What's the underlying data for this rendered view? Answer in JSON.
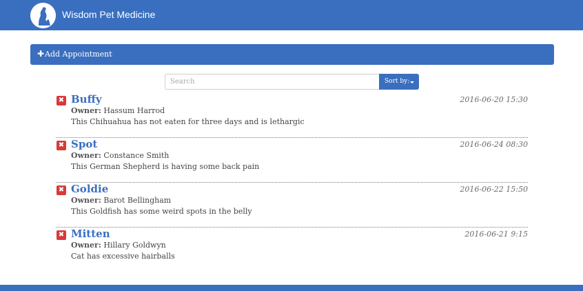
{
  "app": {
    "brand": "Wisdom Pet Medicine"
  },
  "add_appointment": {
    "label": "Add Appointment",
    "icon": "plus-icon"
  },
  "search": {
    "placeholder": "Search",
    "value": ""
  },
  "sort": {
    "label": "Sort by:"
  },
  "appointments": [
    {
      "pet": "Buffy",
      "owner_label": "Owner:",
      "owner": "Hassum Harrod",
      "notes": "This Chihuahua has not eaten for three days and is lethargic",
      "date": "2016-06-20 15:30"
    },
    {
      "pet": "Spot",
      "owner_label": "Owner:",
      "owner": "Constance Smith",
      "notes": "This German Shepherd is having some back pain",
      "date": "2016-06-24 08:30"
    },
    {
      "pet": "Goldie",
      "owner_label": "Owner:",
      "owner": "Barot Bellingham",
      "notes": "This Goldfish has some weird spots in the belly",
      "date": "2016-06-22 15:50"
    },
    {
      "pet": "Mitten",
      "owner_label": "Owner:",
      "owner": "Hillary Goldwyn",
      "notes": "Cat has excessive hairballs",
      "date": "2016-06-21 9:15"
    }
  ],
  "colors": {
    "primary": "#3a6fc0",
    "danger": "#d83a3a",
    "text": "#444444"
  },
  "icons": {
    "logo": "pet-logo-icon",
    "delete": "close-icon",
    "sort_caret": "caret-down-icon"
  }
}
